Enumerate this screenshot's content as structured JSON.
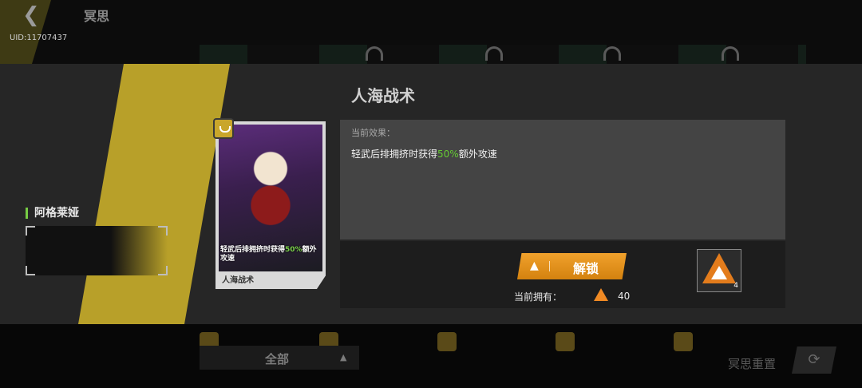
{
  "header": {
    "title": "冥思",
    "uid": "UID:11707437",
    "back_icon": "back-arrow-icon"
  },
  "modal": {
    "character_name": "阿格莱娅",
    "skill_title": "人海战术",
    "card": {
      "desc_before": "轻武后排拥挤时获得",
      "desc_highlight": "50%",
      "desc_after": "额外攻速",
      "name": "人海战术"
    },
    "effect": {
      "label": "当前效果：",
      "text_before": "轻武后排拥挤时获得",
      "text_highlight": "50%",
      "text_after": "额外攻速"
    },
    "unlock_button": "解锁",
    "owned_label": "当前拥有：",
    "owned_count": "40",
    "cost_item_qty": "4"
  },
  "footer": {
    "filter_label": "全部",
    "reset_label": "冥思重置"
  },
  "colors": {
    "accent_yellow": "#b8a029",
    "highlight_green": "#66cc33",
    "unlock_orange": "#e8951f"
  }
}
